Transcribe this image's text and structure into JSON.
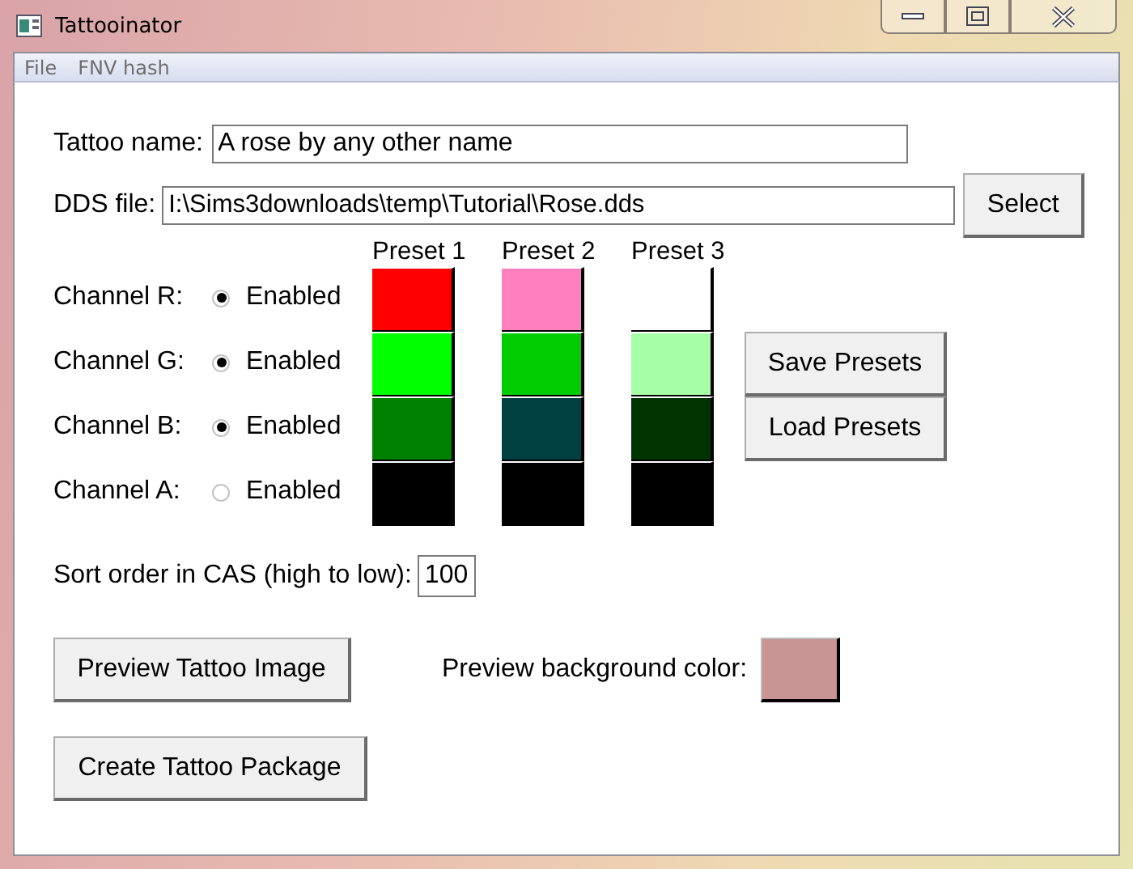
{
  "window": {
    "title": "Tattooinator"
  },
  "menu": [
    {
      "label": "File"
    },
    {
      "label": "FNV hash"
    }
  ],
  "tattoo_name": {
    "label": "Tattoo name:",
    "value": "A rose by any other name"
  },
  "dds_file": {
    "label": "DDS file:",
    "value": "I:\\Sims3downloads\\temp\\Tutorial\\Rose.dds",
    "button": "Select"
  },
  "channels": [
    {
      "label": "Channel R:",
      "option": "Enabled",
      "checked": true
    },
    {
      "label": "Channel G:",
      "option": "Enabled",
      "checked": true
    },
    {
      "label": "Channel B:",
      "option": "Enabled",
      "checked": true
    },
    {
      "label": "Channel A:",
      "option": "Enabled",
      "checked": false
    }
  ],
  "presets": [
    {
      "title": "Preset 1",
      "swatches": [
        {
          "color": "#ff0000"
        },
        {
          "color": "#00ff00"
        },
        {
          "color": "#008000"
        },
        {
          "color": "#000000"
        }
      ]
    },
    {
      "title": "Preset 2",
      "swatches": [
        {
          "color": "#ff7fbf"
        },
        {
          "color": "#00cc00"
        },
        {
          "color": "#004040"
        },
        {
          "color": "#000000"
        }
      ]
    },
    {
      "title": "Preset 3",
      "swatches": [
        {
          "color": "#ffffff"
        },
        {
          "color": "#a6ffa6"
        },
        {
          "color": "#003300"
        },
        {
          "color": "#000000"
        }
      ]
    }
  ],
  "preset_buttons": [
    "Save Presets",
    "Load Presets"
  ],
  "sort_order": {
    "label": "Sort order in CAS (high to low):",
    "value": "100"
  },
  "preview_button": "Preview Tattoo Image",
  "preview_background": {
    "label": "Preview background color:",
    "color": "#c89494"
  },
  "create_button": "Create Tattoo Package"
}
